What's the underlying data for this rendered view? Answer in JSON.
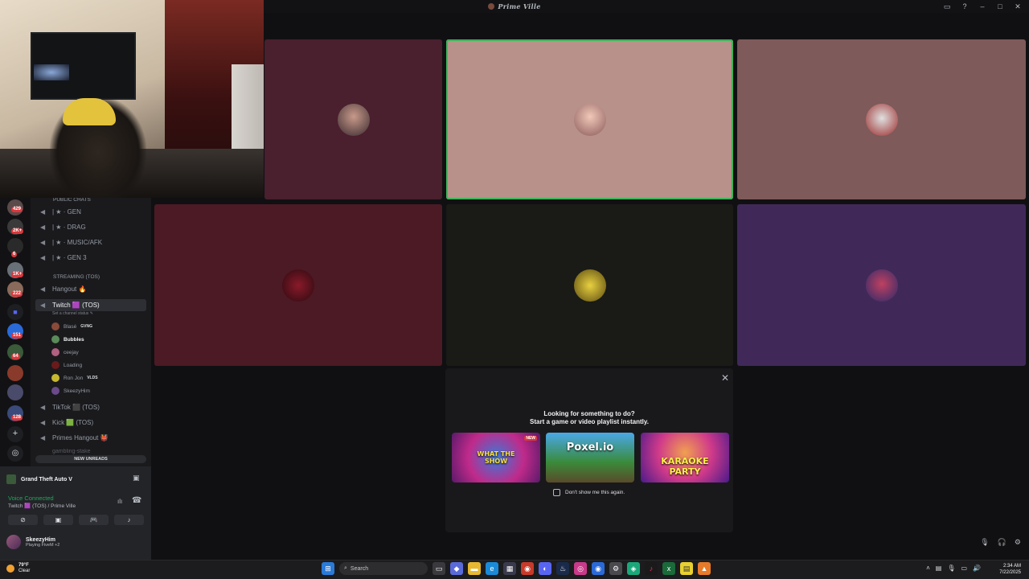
{
  "window": {
    "title": "Prime Ville"
  },
  "sidebar": {
    "badges": [
      "429",
      "2K+",
      "6",
      "1K+",
      "222",
      "151",
      "64",
      "128"
    ],
    "categories": {
      "public": "Public Chats",
      "streaming": "STREAMING (TOS)"
    },
    "channels": {
      "gen": "| ★ · GEN",
      "drag": "| ★ · DRAG",
      "music": "| ★ · MUSIC/AFK",
      "gen3": "| ★ · GEN 3",
      "hangout": "Hangout 🔥",
      "twitch": "Twitch 🟪 (TOS)",
      "twitch_status": "Set a channel status ✎",
      "tiktok": "TikTok ⬛ (TOS)",
      "kick": "Kick 🟩 (TOS)",
      "primes_hangout": "Primes Hangout 👹",
      "gambling": "gambling-stake"
    },
    "voice_users": [
      {
        "name": "Blasé",
        "tag": "GVNG",
        "color": "#8a4a3a"
      },
      {
        "name": "Bubbles",
        "tag": "",
        "color": "#5a8a5a"
      },
      {
        "name": "ceejay",
        "tag": "",
        "color": "#b06080"
      },
      {
        "name": "Loading",
        "tag": "",
        "color": "#6a1a1a"
      },
      {
        "name": "Ron Jon",
        "tag": "VLDS",
        "color": "#c8b830"
      },
      {
        "name": "SkeezyHim",
        "tag": "",
        "color": "#6a4a8a"
      }
    ],
    "new_unreads": "NEW UNREADS"
  },
  "panel": {
    "game": "Grand Theft Auto V",
    "voice_connected": "Voice Connected",
    "voice_channel": "Twitch 🟪 (TOS) / Prime Ville",
    "username": "SkeezyHim",
    "status": "Playing FiveM +2"
  },
  "activity": {
    "line1": "Looking for something to do?",
    "line2": "Start a game or video playlist instantly.",
    "cards": [
      {
        "label": "WHAT THE SHOW",
        "badge": "NEW"
      },
      {
        "label": "Poxel.io",
        "badge": ""
      },
      {
        "label": "KARAOKE PARTY",
        "badge": ""
      }
    ],
    "dont_show": "Don't show me this again."
  },
  "taskbar": {
    "temp": "79°F",
    "weather": "Clear",
    "search": "Search",
    "time": "2:34 AM",
    "date": "7/22/2025"
  },
  "colors": {
    "tile1": "#4a1f2e",
    "tile2": "#b8928a",
    "tile3": "#7e5a5a",
    "tile4": "#4c1a24",
    "tile5": "#1a1b17",
    "tile6": "#402959",
    "speaking": "#3fb35a"
  }
}
